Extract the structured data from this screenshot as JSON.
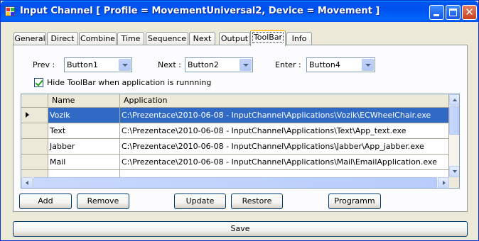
{
  "window": {
    "title": "Input Channel [ Profile = MovementUniversal2, Device = Movement ]"
  },
  "tabs": [
    "General",
    "Direct",
    "Combine",
    "Time",
    "Sequence",
    "Next",
    "Output",
    "ToolBar",
    "Info"
  ],
  "active_tab": "ToolBar",
  "form": {
    "prev_label": "Prev :",
    "prev_value": "Button1",
    "next_label": "Next :",
    "next_value": "Button2",
    "enter_label": "Enter :",
    "enter_value": "Button4",
    "hide_toolbar_label": "Hide ToolBar when application is runnning",
    "hide_toolbar_checked": true
  },
  "grid": {
    "columns": [
      "Name",
      "Application"
    ],
    "rows": [
      {
        "name": "Vozik",
        "app": "C:\\Prezentace\\2010-06-08 - InputChannel\\Applications\\Vozik\\ECWheelChair.exe",
        "selected": true
      },
      {
        "name": "Text",
        "app": "C:\\Prezentace\\2010-06-08 - InputChannel\\Applications\\Text\\App_text.exe"
      },
      {
        "name": "Jabber",
        "app": "C:\\Prezentace\\2010-06-08 - InputChannel\\Applications\\Jabber\\App_jabber.exe"
      },
      {
        "name": "Mail",
        "app": "C:\\Prezentace\\2010-06-08 - InputChannel\\Applications\\Mail\\EmailApplication.exe"
      }
    ]
  },
  "buttons": {
    "add": "Add",
    "remove": "Remove",
    "update": "Update",
    "restore": "Restore",
    "programm": "Programm",
    "save": "Save"
  },
  "colors": {
    "title_bar": "#0053ee",
    "selection": "#316ac5",
    "window_bg": "#ece9d8",
    "active_tab_highlight": "#ffc83c"
  }
}
